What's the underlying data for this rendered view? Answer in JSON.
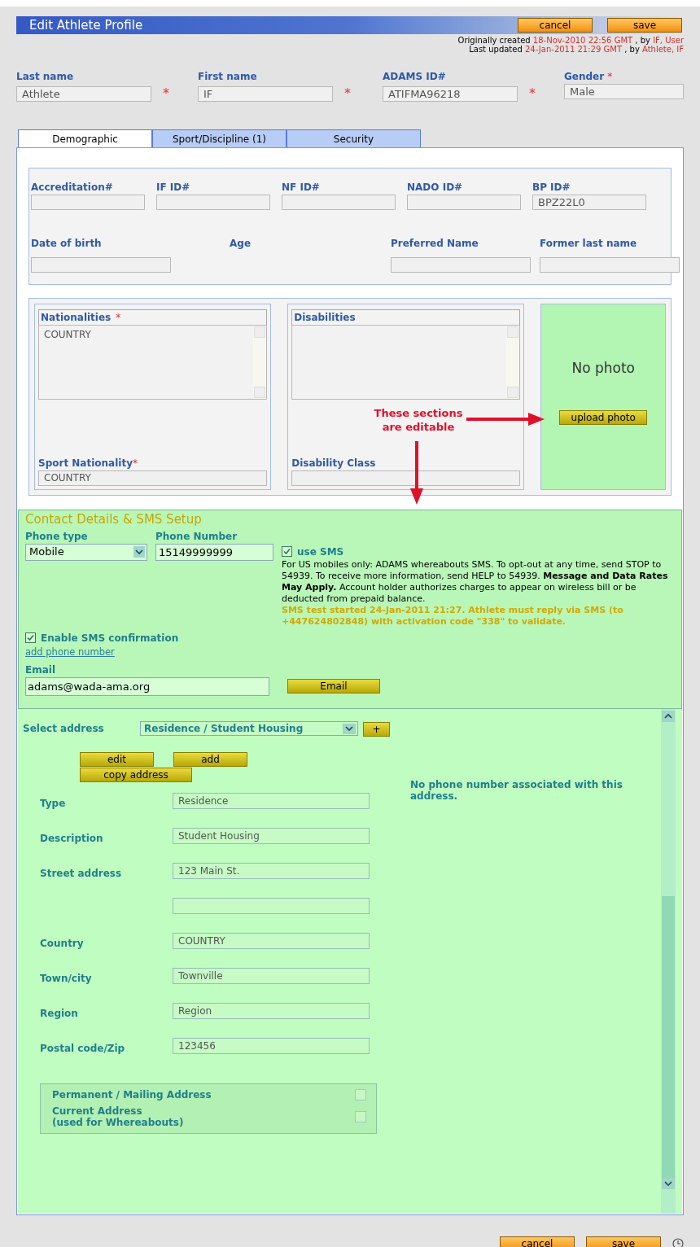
{
  "header": {
    "title": "Edit Athlete Profile",
    "buttons": [
      {
        "label": "cancel"
      },
      {
        "label": "save"
      }
    ],
    "meta": [
      {
        "prefix": "Originally created",
        "date": "18-Nov-2010 22:56 GMT",
        "by": ", by",
        "who": "IF, User"
      },
      {
        "prefix": "Last updated",
        "date": "24-Jan-2011 21:29 GMT",
        "by": ", by",
        "who": "Athlete, IF"
      }
    ]
  },
  "identity": [
    {
      "label": "Last name",
      "value": "Athlete",
      "field_star": "*"
    },
    {
      "label": "First name",
      "value": "IF",
      "field_star": "*"
    },
    {
      "label": "ADAMS ID#",
      "value": "ATIFMA96218",
      "field_star": "*"
    },
    {
      "label": "Gender",
      "label_star": "*",
      "value": "Male"
    }
  ],
  "tabs": [
    {
      "label": "Demographic",
      "selected": true
    },
    {
      "label": "Sport/Discipline (1)",
      "selected": false
    },
    {
      "label": "Security",
      "selected": false
    }
  ],
  "ids": [
    {
      "label": "Accreditation#"
    },
    {
      "label": "IF ID#"
    },
    {
      "label": "NF ID#"
    },
    {
      "label": "NADO ID#"
    },
    {
      "label": "BP ID#",
      "value": "BPZ22L0"
    }
  ],
  "personal": [
    {
      "label": "Date of birth",
      "kind": "field"
    },
    {
      "label": "Age",
      "kind": "label"
    },
    {
      "label": "Preferred Name",
      "kind": "field"
    },
    {
      "label": "Former last name",
      "kind": "field"
    }
  ],
  "nationalities": {
    "label": "Nationalities",
    "star": "*",
    "items": [
      "COUNTRY"
    ]
  },
  "disabilities": {
    "label": "Disabilities"
  },
  "sport_nationality": {
    "label": "Sport Nationality",
    "star": "*",
    "value": "COUNTRY"
  },
  "disability_class": {
    "label": "Disability Class"
  },
  "photo": {
    "text": "No photo",
    "button": "upload photo"
  },
  "annotation": "These sections are editable",
  "contact": {
    "title": "Contact Details & SMS Setup",
    "phone_type": {
      "label": "Phone type",
      "value": "Mobile"
    },
    "phone_number": {
      "label": "Phone Number",
      "value": "15149999999"
    },
    "use_sms": {
      "label": "use SMS",
      "checked": true
    },
    "sms_info": "For US mobiles only: ADAMS whereabouts SMS. To opt-out at any time, send STOP to 54939. To receive more information, send HELP to 54939. **Message and Data Rates May Apply.** Account holder authorizes charges to appear on wireless bill or be deducted from prepaid balance.",
    "sms_status": "SMS test started 24-Jan-2011 21:27. Athlete must reply via SMS (to +447624802848) with activation code \"338\" to validate.",
    "enable_sms": {
      "label": "Enable SMS confirmation",
      "checked": true
    },
    "add_phone": "add phone number",
    "email": {
      "label": "Email",
      "value": "adams@wada-ama.org",
      "button": "Email"
    }
  },
  "address": {
    "select": {
      "label": "Select address",
      "value": "Residence / Student Housing",
      "add": "+"
    },
    "buttons": [
      {
        "label": "edit"
      },
      {
        "label": "add"
      },
      {
        "label": "copy address"
      }
    ],
    "note": "No phone number associated with this address.",
    "fields": [
      {
        "kind": "field",
        "label": "Type",
        "value": "Residence"
      },
      {
        "kind": "field",
        "label": "Description",
        "value": "Student Housing"
      },
      {
        "kind": "field",
        "label": "Street address",
        "value": "123 Main St."
      },
      {
        "kind": "extra"
      },
      {
        "kind": "field",
        "label": "Country",
        "value": "COUNTRY"
      },
      {
        "kind": "field",
        "label": "Town/city",
        "value": "Townville"
      },
      {
        "kind": "field",
        "label": "Region",
        "value": "Region"
      },
      {
        "kind": "field",
        "label": "Postal code/Zip",
        "value": "123456"
      }
    ],
    "flags": [
      {
        "label": "Permanent / Mailing Address",
        "checked": false
      },
      {
        "label": "Current Address\n(used for Whereabouts)",
        "checked": false
      }
    ]
  },
  "footer": {
    "buttons": [
      {
        "label": "cancel"
      },
      {
        "label": "save"
      }
    ]
  }
}
